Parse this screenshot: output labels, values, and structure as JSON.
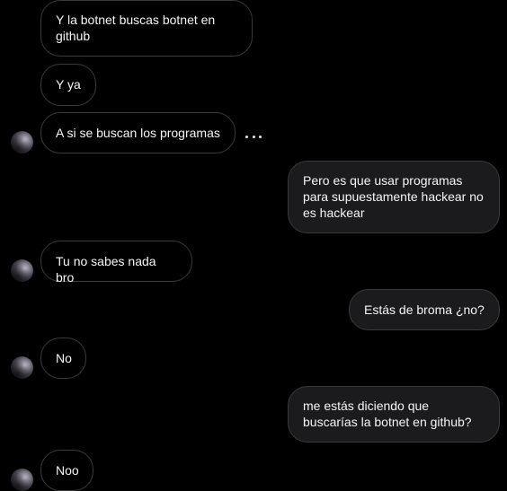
{
  "chat": {
    "messages": [
      {
        "from": "them",
        "text": "Y la botnet buscas botnet en github"
      },
      {
        "from": "them",
        "text": "Y ya"
      },
      {
        "from": "them",
        "text": "A si se buscan los programas"
      },
      {
        "from": "me",
        "text": "Pero es que usar programas para supuestamente hackear no es hackear"
      },
      {
        "from": "them",
        "text": "Tu no sabes nada bro"
      },
      {
        "from": "me",
        "text": "Estás de broma ¿no?"
      },
      {
        "from": "them",
        "text": "No"
      },
      {
        "from": "me",
        "text": "me estás diciendo que buscarías la botnet en github?"
      },
      {
        "from": "them",
        "text": "Noo"
      }
    ],
    "options_icon": "more-horizontal-icon"
  }
}
